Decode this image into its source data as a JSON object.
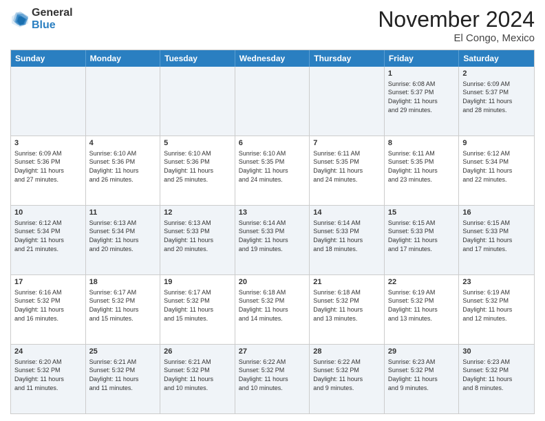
{
  "header": {
    "logo_line1": "General",
    "logo_line2": "Blue",
    "month": "November 2024",
    "location": "El Congo, Mexico"
  },
  "days": [
    "Sunday",
    "Monday",
    "Tuesday",
    "Wednesday",
    "Thursday",
    "Friday",
    "Saturday"
  ],
  "rows": [
    [
      {
        "day": "",
        "text": ""
      },
      {
        "day": "",
        "text": ""
      },
      {
        "day": "",
        "text": ""
      },
      {
        "day": "",
        "text": ""
      },
      {
        "day": "",
        "text": ""
      },
      {
        "day": "1",
        "text": "Sunrise: 6:08 AM\nSunset: 5:37 PM\nDaylight: 11 hours\nand 29 minutes."
      },
      {
        "day": "2",
        "text": "Sunrise: 6:09 AM\nSunset: 5:37 PM\nDaylight: 11 hours\nand 28 minutes."
      }
    ],
    [
      {
        "day": "3",
        "text": "Sunrise: 6:09 AM\nSunset: 5:36 PM\nDaylight: 11 hours\nand 27 minutes."
      },
      {
        "day": "4",
        "text": "Sunrise: 6:10 AM\nSunset: 5:36 PM\nDaylight: 11 hours\nand 26 minutes."
      },
      {
        "day": "5",
        "text": "Sunrise: 6:10 AM\nSunset: 5:36 PM\nDaylight: 11 hours\nand 25 minutes."
      },
      {
        "day": "6",
        "text": "Sunrise: 6:10 AM\nSunset: 5:35 PM\nDaylight: 11 hours\nand 24 minutes."
      },
      {
        "day": "7",
        "text": "Sunrise: 6:11 AM\nSunset: 5:35 PM\nDaylight: 11 hours\nand 24 minutes."
      },
      {
        "day": "8",
        "text": "Sunrise: 6:11 AM\nSunset: 5:35 PM\nDaylight: 11 hours\nand 23 minutes."
      },
      {
        "day": "9",
        "text": "Sunrise: 6:12 AM\nSunset: 5:34 PM\nDaylight: 11 hours\nand 22 minutes."
      }
    ],
    [
      {
        "day": "10",
        "text": "Sunrise: 6:12 AM\nSunset: 5:34 PM\nDaylight: 11 hours\nand 21 minutes."
      },
      {
        "day": "11",
        "text": "Sunrise: 6:13 AM\nSunset: 5:34 PM\nDaylight: 11 hours\nand 20 minutes."
      },
      {
        "day": "12",
        "text": "Sunrise: 6:13 AM\nSunset: 5:33 PM\nDaylight: 11 hours\nand 20 minutes."
      },
      {
        "day": "13",
        "text": "Sunrise: 6:14 AM\nSunset: 5:33 PM\nDaylight: 11 hours\nand 19 minutes."
      },
      {
        "day": "14",
        "text": "Sunrise: 6:14 AM\nSunset: 5:33 PM\nDaylight: 11 hours\nand 18 minutes."
      },
      {
        "day": "15",
        "text": "Sunrise: 6:15 AM\nSunset: 5:33 PM\nDaylight: 11 hours\nand 17 minutes."
      },
      {
        "day": "16",
        "text": "Sunrise: 6:15 AM\nSunset: 5:33 PM\nDaylight: 11 hours\nand 17 minutes."
      }
    ],
    [
      {
        "day": "17",
        "text": "Sunrise: 6:16 AM\nSunset: 5:32 PM\nDaylight: 11 hours\nand 16 minutes."
      },
      {
        "day": "18",
        "text": "Sunrise: 6:17 AM\nSunset: 5:32 PM\nDaylight: 11 hours\nand 15 minutes."
      },
      {
        "day": "19",
        "text": "Sunrise: 6:17 AM\nSunset: 5:32 PM\nDaylight: 11 hours\nand 15 minutes."
      },
      {
        "day": "20",
        "text": "Sunrise: 6:18 AM\nSunset: 5:32 PM\nDaylight: 11 hours\nand 14 minutes."
      },
      {
        "day": "21",
        "text": "Sunrise: 6:18 AM\nSunset: 5:32 PM\nDaylight: 11 hours\nand 13 minutes."
      },
      {
        "day": "22",
        "text": "Sunrise: 6:19 AM\nSunset: 5:32 PM\nDaylight: 11 hours\nand 13 minutes."
      },
      {
        "day": "23",
        "text": "Sunrise: 6:19 AM\nSunset: 5:32 PM\nDaylight: 11 hours\nand 12 minutes."
      }
    ],
    [
      {
        "day": "24",
        "text": "Sunrise: 6:20 AM\nSunset: 5:32 PM\nDaylight: 11 hours\nand 11 minutes."
      },
      {
        "day": "25",
        "text": "Sunrise: 6:21 AM\nSunset: 5:32 PM\nDaylight: 11 hours\nand 11 minutes."
      },
      {
        "day": "26",
        "text": "Sunrise: 6:21 AM\nSunset: 5:32 PM\nDaylight: 11 hours\nand 10 minutes."
      },
      {
        "day": "27",
        "text": "Sunrise: 6:22 AM\nSunset: 5:32 PM\nDaylight: 11 hours\nand 10 minutes."
      },
      {
        "day": "28",
        "text": "Sunrise: 6:22 AM\nSunset: 5:32 PM\nDaylight: 11 hours\nand 9 minutes."
      },
      {
        "day": "29",
        "text": "Sunrise: 6:23 AM\nSunset: 5:32 PM\nDaylight: 11 hours\nand 9 minutes."
      },
      {
        "day": "30",
        "text": "Sunrise: 6:23 AM\nSunset: 5:32 PM\nDaylight: 11 hours\nand 8 minutes."
      }
    ]
  ]
}
